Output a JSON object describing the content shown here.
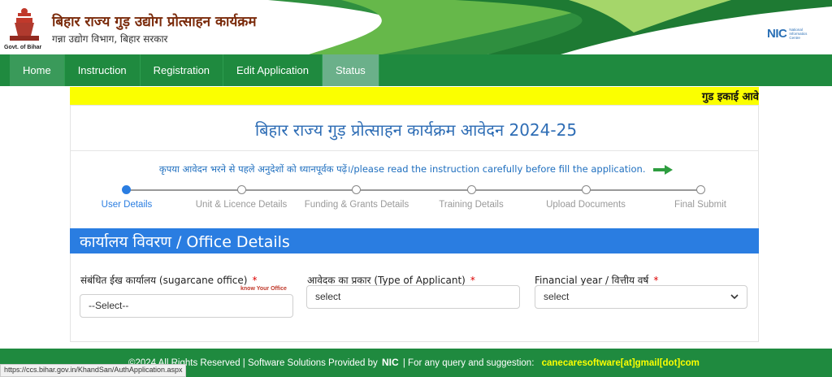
{
  "header": {
    "title": "बिहार राज्य गुड़ उद्योग प्रोत्साहन कार्यक्रम",
    "subtitle": "गन्ना उद्योग विभाग, बिहार सरकार",
    "logo_caption": "Govt. of Bihar",
    "nic_logo_text": "NIC",
    "nic_caption": "National Informatics Centre",
    "colors": {
      "green": "#1f8a3f",
      "title": "#7a2a0a"
    }
  },
  "nav": {
    "items": [
      {
        "label": "Home"
      },
      {
        "label": "Instruction"
      },
      {
        "label": "Registration"
      },
      {
        "label": "Edit Application"
      },
      {
        "label": "Status"
      }
    ]
  },
  "marquee": {
    "text": "गुड इकाई आवे"
  },
  "form": {
    "title": "बिहार राज्य गुड़ प्रोत्साहन कार्यक्रम आवेदन 2024-25",
    "instruction": "कृपया आवेदन भरने से पहले अनुदेशों को ध्यानपूर्वक पढ़ें।/please read the instruction carefully before fill the application.",
    "steps": [
      {
        "label": "User Details"
      },
      {
        "label": "Unit & Licence Details"
      },
      {
        "label": "Funding & Grants Details"
      },
      {
        "label": "Training Details"
      },
      {
        "label": "Upload Documents"
      },
      {
        "label": "Final Submit"
      }
    ],
    "section_title": "कार्यालय विवरण / Office Details",
    "fields": {
      "office": {
        "label": "संबंधित ईख कार्यालय (sugarcane office)",
        "required": "*",
        "helper": "know Your Office",
        "value": "--Select--"
      },
      "applicant_type": {
        "label": "आवेदक का प्रकार (Type of Applicant)",
        "required": "*",
        "value": "select"
      },
      "financial_year": {
        "label": "Financial year / वित्तीय वर्ष",
        "required": "*",
        "value": "select"
      }
    },
    "colors": {
      "accent": "#2a7de1",
      "instruction": "#1f6fbf"
    }
  },
  "footer": {
    "copyright": "©2024 All Rights Reserved | Software Solutions Provided by",
    "nic_text": "NIC",
    "query_text": "| For any query and suggestion:",
    "email": "canecaresoftware[at]gmail[dot]com"
  },
  "status_bar": {
    "url": "https://ccs.bihar.gov.in/KhandSan/AuthApplication.aspx"
  }
}
